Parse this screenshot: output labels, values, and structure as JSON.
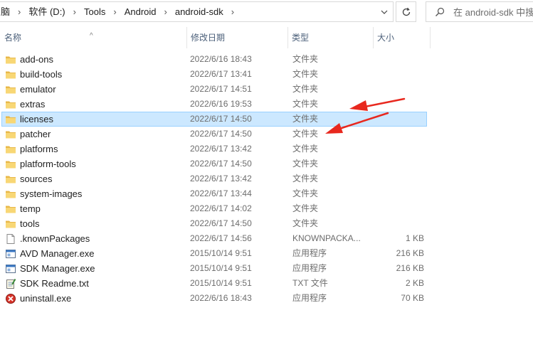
{
  "breadcrumb": {
    "items": [
      "脑",
      "软件 (D:)",
      "Tools",
      "Android",
      "android-sdk"
    ],
    "separator": "›"
  },
  "search": {
    "placeholder": "在 android-sdk 中搜"
  },
  "columns": {
    "name": "名称",
    "date": "修改日期",
    "type": "类型",
    "size": "大小"
  },
  "files": [
    {
      "name": "add-ons",
      "date": "2022/6/16 18:43",
      "type": "文件夹",
      "size": "",
      "icon": "folder-icon"
    },
    {
      "name": "build-tools",
      "date": "2022/6/17 13:41",
      "type": "文件夹",
      "size": "",
      "icon": "folder-icon"
    },
    {
      "name": "emulator",
      "date": "2022/6/17 14:51",
      "type": "文件夹",
      "size": "",
      "icon": "folder-icon"
    },
    {
      "name": "extras",
      "date": "2022/6/16 19:53",
      "type": "文件夹",
      "size": "",
      "icon": "folder-icon"
    },
    {
      "name": "licenses",
      "date": "2022/6/17 14:50",
      "type": "文件夹",
      "size": "",
      "icon": "folder-icon",
      "selected": true
    },
    {
      "name": "patcher",
      "date": "2022/6/17 14:50",
      "type": "文件夹",
      "size": "",
      "icon": "folder-icon"
    },
    {
      "name": "platforms",
      "date": "2022/6/17 13:42",
      "type": "文件夹",
      "size": "",
      "icon": "folder-icon"
    },
    {
      "name": "platform-tools",
      "date": "2022/6/17 14:50",
      "type": "文件夹",
      "size": "",
      "icon": "folder-icon"
    },
    {
      "name": "sources",
      "date": "2022/6/17 13:42",
      "type": "文件夹",
      "size": "",
      "icon": "folder-icon"
    },
    {
      "name": "system-images",
      "date": "2022/6/17 13:44",
      "type": "文件夹",
      "size": "",
      "icon": "folder-icon"
    },
    {
      "name": "temp",
      "date": "2022/6/17 14:02",
      "type": "文件夹",
      "size": "",
      "icon": "folder-icon"
    },
    {
      "name": "tools",
      "date": "2022/6/17 14:50",
      "type": "文件夹",
      "size": "",
      "icon": "folder-icon"
    },
    {
      "name": ".knownPackages",
      "date": "2022/6/17 14:56",
      "type": "KNOWNPACKA...",
      "size": "1 KB",
      "icon": "file-icon"
    },
    {
      "name": "AVD Manager.exe",
      "date": "2015/10/14 9:51",
      "type": "应用程序",
      "size": "216 KB",
      "icon": "exe-window-icon"
    },
    {
      "name": "SDK Manager.exe",
      "date": "2015/10/14 9:51",
      "type": "应用程序",
      "size": "216 KB",
      "icon": "exe-window-icon"
    },
    {
      "name": "SDK Readme.txt",
      "date": "2015/10/14 9:51",
      "type": "TXT 文件",
      "size": "2 KB",
      "icon": "notepad-icon"
    },
    {
      "name": "uninstall.exe",
      "date": "2022/6/16 18:43",
      "type": "应用程序",
      "size": "70 KB",
      "icon": "uninstall-icon"
    }
  ],
  "colors": {
    "selection_bg": "#cce8ff",
    "selection_border": "#99d1ff",
    "folder": "#f8d775",
    "annotation_arrow": "#e8281e"
  }
}
